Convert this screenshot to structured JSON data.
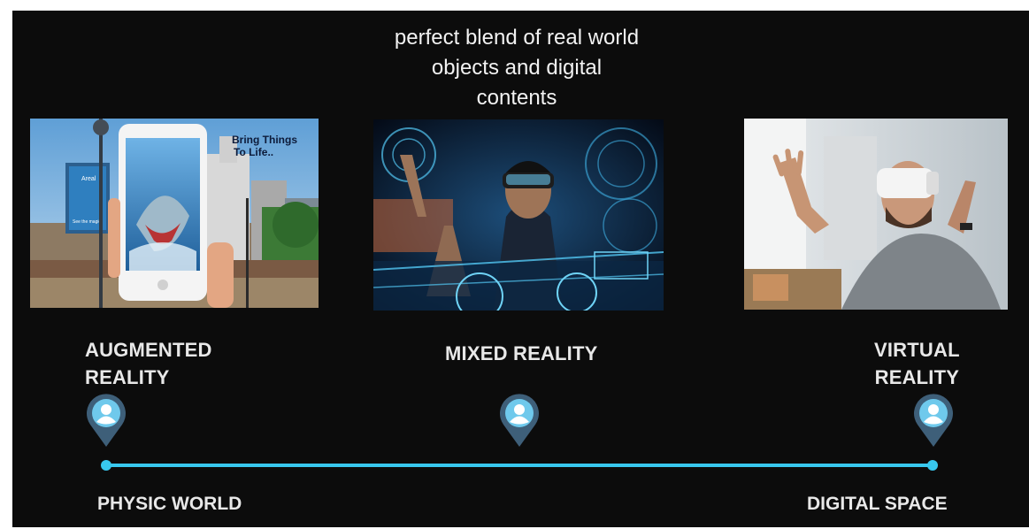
{
  "headline": {
    "line1": "perfect blend of real world",
    "line2": "objects and digital",
    "line3": "contents"
  },
  "panels": [
    {
      "label_line1": "AUGMENTED",
      "label_line2": "REALITY",
      "image_text": {
        "billboard_brand": "Areal",
        "billboard_caption": "See the magic",
        "slogan_line1": "Bring Things",
        "slogan_line2": "To Life.."
      },
      "icon": "user-location-pin-icon"
    },
    {
      "label_line1": "MIXED REALITY",
      "icon": "user-location-pin-icon"
    },
    {
      "label_line1": "VIRTUAL",
      "label_line2": "REALITY",
      "icon": "user-location-pin-icon"
    }
  ],
  "axis": {
    "start_label": "PHYSIC WORLD",
    "end_label": "DIGITAL SPACE"
  },
  "colors": {
    "background": "#0c0c0c",
    "accent_line": "#38c8ee",
    "pin_outer": "#3e5f79",
    "pin_inner": "#6fc9ec",
    "text": "#e8e8e8"
  }
}
